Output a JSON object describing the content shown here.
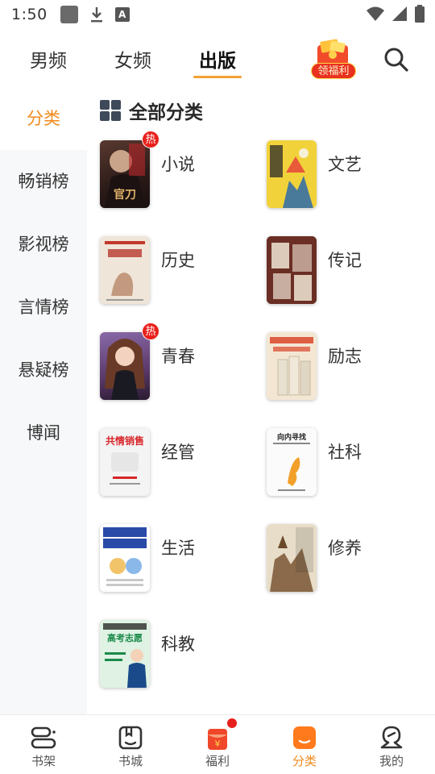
{
  "status_bar": {
    "time": "1:50"
  },
  "top_tabs": [
    {
      "label": "男频",
      "active": false
    },
    {
      "label": "女频",
      "active": false
    },
    {
      "label": "出版",
      "active": true
    }
  ],
  "welfare": {
    "label": "领福利"
  },
  "sidebar": {
    "items": [
      {
        "label": "分类",
        "active": true
      },
      {
        "label": "畅销榜",
        "active": false
      },
      {
        "label": "影视榜",
        "active": false
      },
      {
        "label": "言情榜",
        "active": false
      },
      {
        "label": "悬疑榜",
        "active": false
      },
      {
        "label": "博闻",
        "active": false
      }
    ]
  },
  "main": {
    "section_title": "全部分类",
    "categories": [
      {
        "label": "小说",
        "hot": true,
        "hot_label": "热",
        "cover_text": "官刀",
        "cover_color": "#3a2a28"
      },
      {
        "label": "文艺",
        "hot": false,
        "cover_text": "",
        "cover_color": "#f2d23a"
      },
      {
        "label": "历史",
        "hot": false,
        "cover_text": "",
        "cover_color": "#efe5d8"
      },
      {
        "label": "传记",
        "hot": false,
        "cover_text": "",
        "cover_color": "#5a2a22"
      },
      {
        "label": "青春",
        "hot": true,
        "hot_label": "热",
        "cover_text": "",
        "cover_color": "#7a5a88"
      },
      {
        "label": "励志",
        "hot": false,
        "cover_text": "",
        "cover_color": "#f3e7d4"
      },
      {
        "label": "经管",
        "hot": false,
        "cover_text": "共情销售",
        "cover_color": "#f4f4f4"
      },
      {
        "label": "社科",
        "hot": false,
        "cover_text": "向内寻找",
        "cover_color": "#fbfbfb"
      },
      {
        "label": "生活",
        "hot": false,
        "cover_text": "",
        "cover_color": "#ffffff"
      },
      {
        "label": "修养",
        "hot": false,
        "cover_text": "",
        "cover_color": "#e8ddc8"
      },
      {
        "label": "科教",
        "hot": false,
        "cover_text": "高考志愿",
        "cover_color": "#dff2e4"
      }
    ]
  },
  "bottom_nav": [
    {
      "label": "书架",
      "icon": "bookshelf-icon",
      "active": false
    },
    {
      "label": "书城",
      "icon": "bookstore-icon",
      "active": false
    },
    {
      "label": "福利",
      "icon": "redpacket-icon",
      "active": false,
      "dot": true
    },
    {
      "label": "分类",
      "icon": "category-icon",
      "active": true
    },
    {
      "label": "我的",
      "icon": "profile-icon",
      "active": false
    }
  ],
  "colors": {
    "accent": "#f08a1c",
    "hot": "#e8201c",
    "underline": "#f2a033"
  }
}
